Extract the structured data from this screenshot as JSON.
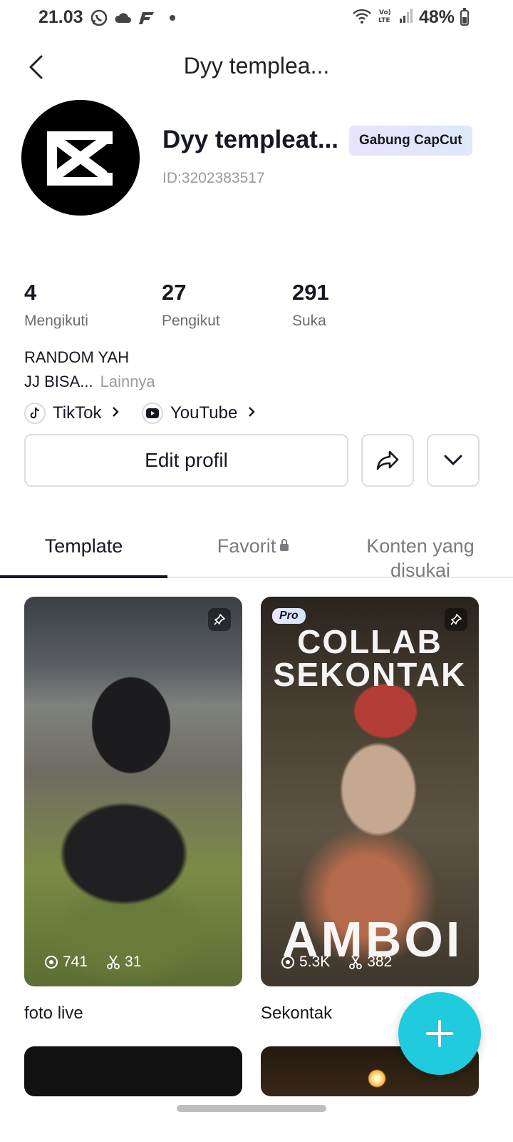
{
  "status_bar": {
    "time": "21.03",
    "battery": "48%"
  },
  "header": {
    "title": "Dyy templea..."
  },
  "profile": {
    "name": "Dyy templeat...",
    "badge": "Gabung CapCut",
    "id": "ID:3202383517",
    "stats": [
      {
        "value": "4",
        "label": "Mengikuti"
      },
      {
        "value": "27",
        "label": "Pengikut"
      },
      {
        "value": "291",
        "label": "Suka"
      }
    ],
    "bio_line1": "RANDOM YAH",
    "bio_line2": "JJ BISA...",
    "bio_more": "Lainnya",
    "links": [
      {
        "label": "TikTok",
        "icon": "tiktok-icon"
      },
      {
        "label": "YouTube",
        "icon": "youtube-icon"
      }
    ],
    "edit_label": "Edit profil"
  },
  "tabs": [
    {
      "label": "Template",
      "active": true
    },
    {
      "label": "Favorit",
      "active": false,
      "locked": true
    },
    {
      "label": "Konten yang disukai",
      "active": false
    }
  ],
  "cards": [
    {
      "title": "foto live",
      "views": "741",
      "uses": "31",
      "pinned": true,
      "pro": false
    },
    {
      "title": "Sekontak",
      "views": "5.3K",
      "uses": "382",
      "pinned": true,
      "pro": true,
      "pro_label": "Pro",
      "overlay_top": "COLLAB SEKONTAK",
      "overlay_bottom": "AMBOI"
    }
  ],
  "colors": {
    "accent": "#20cbde",
    "text": "#161823",
    "muted": "#9a9ba0"
  }
}
